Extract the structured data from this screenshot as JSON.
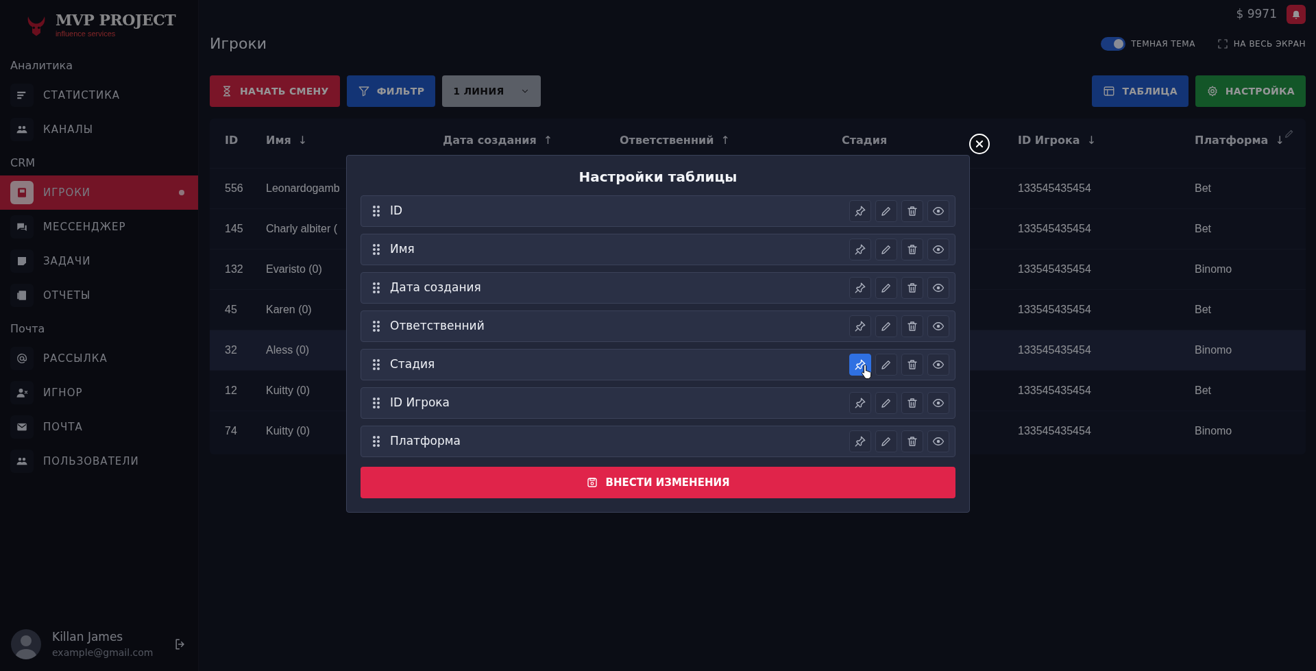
{
  "logo": {
    "name": "MVP PROJECT",
    "tagline": "influence services"
  },
  "sidebar": {
    "sections": [
      {
        "title": "Аналитика",
        "items": [
          {
            "label": "СТАТИСТИКА",
            "selected": false
          },
          {
            "label": "КАНАЛЫ",
            "selected": false
          }
        ]
      },
      {
        "title": "CRM",
        "items": [
          {
            "label": "ИГРОКИ",
            "selected": true
          },
          {
            "label": "МЕССЕНДЖЕР",
            "selected": false
          },
          {
            "label": "ЗАДАЧИ",
            "selected": false
          },
          {
            "label": "ОТЧЕТЫ",
            "selected": false
          }
        ]
      },
      {
        "title": "Почта",
        "items": [
          {
            "label": "РАССЫЛКА",
            "selected": false
          },
          {
            "label": "ИГНОР",
            "selected": false
          },
          {
            "label": "ПОЧТА",
            "selected": false
          },
          {
            "label": "ПОЛЬЗОВАТЕЛИ",
            "selected": false
          }
        ]
      }
    ]
  },
  "user": {
    "name": "Killan James",
    "email": "example@gmail.com"
  },
  "balance": "$ 9971",
  "page_title": "Игроки",
  "dark_theme": {
    "label": "ТЕМНАЯ ТЕМА",
    "on": true
  },
  "fullscreen": {
    "label": "НА ВЕСЬ ЭКРАН"
  },
  "toolbar": {
    "left": [
      {
        "label": "НАЧАТЬ СМЕНУ",
        "kind": "danger"
      },
      {
        "label": "ФИЛЬТР",
        "kind": "primary"
      },
      {
        "label": "1 ЛИНИЯ",
        "kind": "select"
      }
    ],
    "right": [
      {
        "label": "ТАБЛИЦА",
        "kind": "primary"
      },
      {
        "label": "НАСТРОЙКА",
        "kind": "success"
      }
    ]
  },
  "table": {
    "columns": [
      {
        "label": "ID"
      },
      {
        "label": "Имя",
        "arrow": "↓"
      },
      {
        "label": "Дата создания",
        "arrow": "↑"
      },
      {
        "label": "Ответственний",
        "arrow": "↑"
      },
      {
        "label": "Стадия"
      },
      {
        "label": "ID Игрока",
        "arrow": "↓"
      },
      {
        "label": "Платформа",
        "arrow": "↓"
      }
    ],
    "rows": [
      {
        "id": "556",
        "name": "Leonardogamb",
        "player_id": "133545435454",
        "platform": "Bet",
        "hovered": false
      },
      {
        "id": "145",
        "name": "Charly albiter (",
        "player_id": "133545435454",
        "platform": "Bet",
        "hovered": false
      },
      {
        "id": "132",
        "name": "Evaristo (0)",
        "player_id": "133545435454",
        "platform": "Binomo",
        "hovered": false
      },
      {
        "id": "45",
        "name": "Karen (0)",
        "player_id": "133545435454",
        "platform": "Bet",
        "hovered": false
      },
      {
        "id": "32",
        "name": "Aless (0)",
        "player_id": "133545435454",
        "platform": "Binomo",
        "hovered": true
      },
      {
        "id": "12",
        "name": "Kuitty (0)",
        "player_id": "133545435454",
        "platform": "Bet",
        "hovered": false
      },
      {
        "id": "74",
        "name": "Kuitty (0)",
        "player_id": "133545435454",
        "platform": "Binomo",
        "hovered": false
      }
    ]
  },
  "modal": {
    "title": "Настройки таблицы",
    "columns": [
      {
        "label": "ID",
        "pin_active": false
      },
      {
        "label": "Имя",
        "pin_active": false
      },
      {
        "label": "Дата создания",
        "pin_active": false
      },
      {
        "label": "Ответственний",
        "pin_active": false
      },
      {
        "label": "Стадия",
        "pin_active": true
      },
      {
        "label": "ID Игрока",
        "pin_active": false
      },
      {
        "label": "Платформа",
        "pin_active": false
      }
    ],
    "submit": "ВНЕСТИ ИЗМЕНЕНИЯ"
  }
}
